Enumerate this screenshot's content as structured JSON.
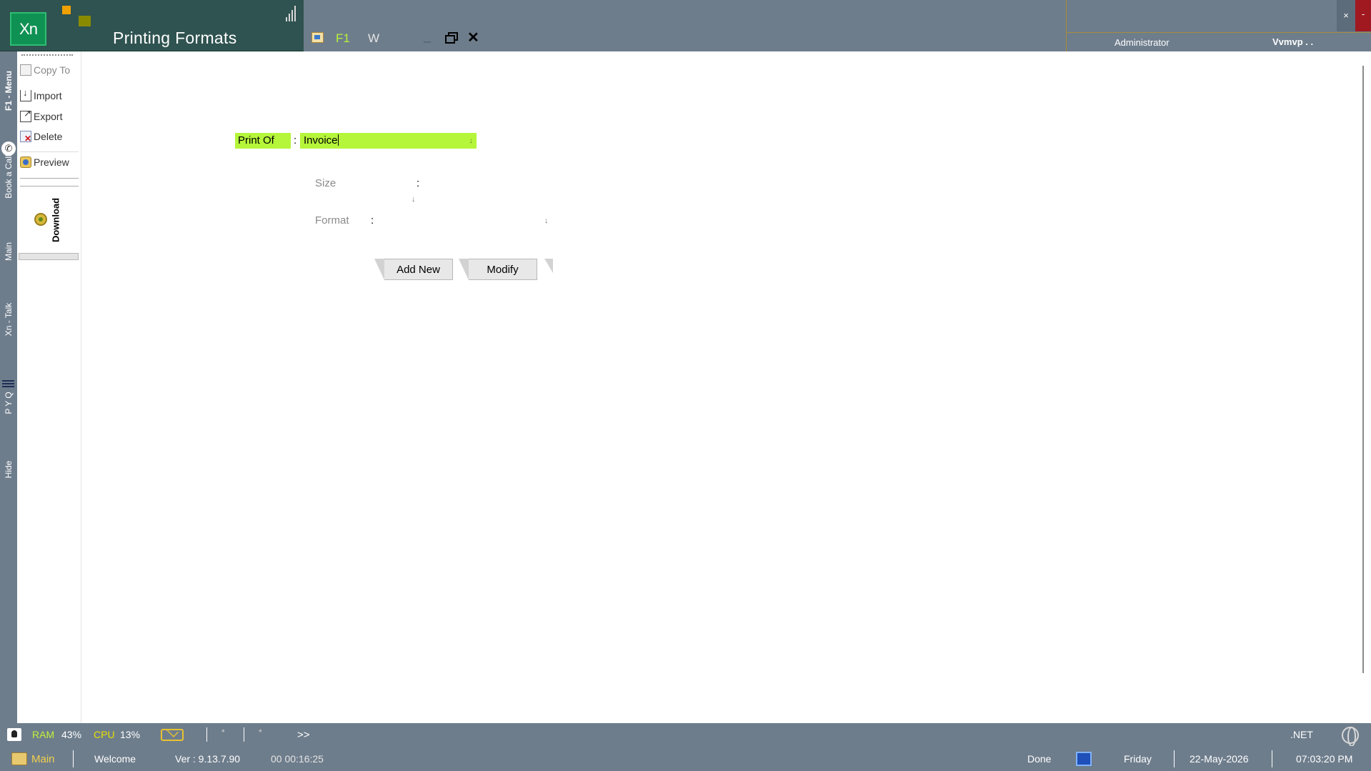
{
  "window": {
    "logo_text": "Xn",
    "title": "Printing Formats",
    "toolbar": {
      "f1_label": "F1",
      "w_label": "W",
      "minimize_glyph": "_",
      "close_glyph": "✕"
    }
  },
  "user_panel": {
    "user": "Administrator",
    "company": "Vvmvp . .",
    "close_glyph": "×",
    "minimize_glyph": "-"
  },
  "side_strip": {
    "menu": "F1 - Menu",
    "book_call": "Book a Call",
    "main": "Main",
    "xn_talk": "Xn - Talk",
    "pyq": "P Y Q",
    "hide": "Hide"
  },
  "side_panel": {
    "items": [
      {
        "label": "Copy To",
        "icon": "copy-icon"
      },
      {
        "label": "Import",
        "icon": "import-icon"
      },
      {
        "label": "Export",
        "icon": "export-icon"
      },
      {
        "label": "Delete",
        "icon": "delete-icon"
      },
      {
        "label": "Preview",
        "icon": "preview-icon"
      }
    ],
    "download_label": "Download"
  },
  "form": {
    "print_of_label": "Print Of",
    "print_of_value": "Invoice",
    "size_label": "Size",
    "size_value": "",
    "format_label": "Format",
    "format_value": "",
    "colon": ":",
    "dropdown_glyph": "↓"
  },
  "buttons": {
    "add_new": "Add New",
    "modify": "Modify"
  },
  "status_bar": {
    "ram_label": "RAM",
    "ram_value": "43%",
    "cpu_label": "CPU",
    "cpu_value": "13%",
    "star1": "*",
    "star2": "*",
    "more": ">>",
    "net_label": ".NET"
  },
  "footer": {
    "main_tab": "Main",
    "welcome": "Welcome",
    "version": "Ver : 9.13.7.90",
    "elapsed": "00 00:16:25",
    "status": "Done",
    "day": "Friday",
    "date": "22-May-2026",
    "time": "07:03:20 PM"
  },
  "colors": {
    "chrome": "#6e7d8c",
    "title_panel": "#2f5350",
    "highlight_green": "#b5f53a",
    "accent_red": "#a01820"
  }
}
